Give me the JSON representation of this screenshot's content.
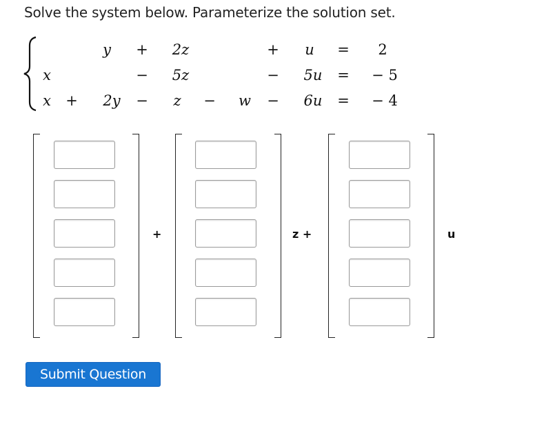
{
  "prompt": "Solve the system below. Parameterize the solution set.",
  "system": {
    "rows": [
      [
        "",
        "",
        "y",
        "+",
        "2z",
        "",
        "",
        "+",
        "u",
        "=",
        "2"
      ],
      [
        "x",
        "",
        "",
        "−",
        "5z",
        "",
        "",
        "−",
        "5u",
        "=",
        "− 5"
      ],
      [
        "x",
        "+",
        "2y",
        "−",
        "z",
        "−",
        "w",
        "−",
        "6u",
        "=",
        "− 4"
      ]
    ]
  },
  "vectors": {
    "constant": {
      "entries": [
        "",
        "",
        "",
        "",
        ""
      ]
    },
    "z_vector": {
      "entries": [
        "",
        "",
        "",
        "",
        ""
      ]
    },
    "u_vector": {
      "entries": [
        "",
        "",
        "",
        "",
        ""
      ]
    },
    "plus1": "+",
    "z_label": "z +",
    "u_label": "u"
  },
  "submit_label": "Submit Question"
}
